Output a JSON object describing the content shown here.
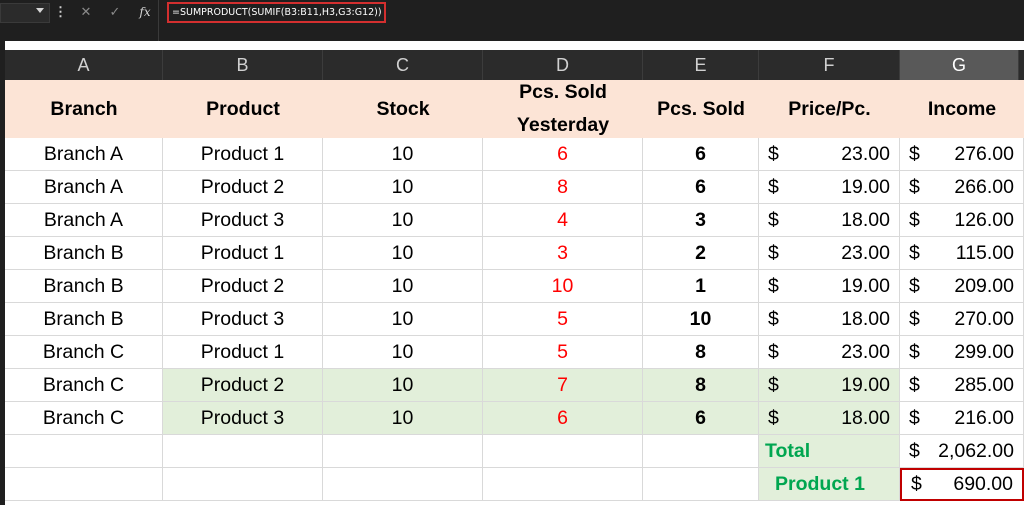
{
  "formula_bar": {
    "name_box": "",
    "cancel_icon": "x-icon",
    "enter_icon": "check-icon",
    "fx_label": "fx",
    "formula": "=SUMPRODUCT(SUMIF(B3:B11,H3,G3:G12))"
  },
  "columns": [
    "A",
    "B",
    "C",
    "D",
    "E",
    "F",
    "G"
  ],
  "selected_column": "G",
  "headers": {
    "branch": "Branch",
    "product": "Product",
    "stock": "Stock",
    "sold_yesterday_1": "Pcs. Sold",
    "sold_yesterday_2": "Yesterday",
    "sold": "Pcs. Sold",
    "price": "Price/Pc.",
    "income": "Income"
  },
  "rows": [
    {
      "branch": "Branch A",
      "product": "Product 1",
      "stock": "10",
      "yesterday": "6",
      "sold": "6",
      "price": "23.00",
      "income": "276.00"
    },
    {
      "branch": "Branch A",
      "product": "Product 2",
      "stock": "10",
      "yesterday": "8",
      "sold": "6",
      "price": "19.00",
      "income": "266.00"
    },
    {
      "branch": "Branch A",
      "product": "Product 3",
      "stock": "10",
      "yesterday": "4",
      "sold": "3",
      "price": "18.00",
      "income": "126.00"
    },
    {
      "branch": "Branch B",
      "product": "Product 1",
      "stock": "10",
      "yesterday": "3",
      "sold": "2",
      "price": "23.00",
      "income": "115.00"
    },
    {
      "branch": "Branch B",
      "product": "Product 2",
      "stock": "10",
      "yesterday": "10",
      "sold": "1",
      "price": "19.00",
      "income": "209.00"
    },
    {
      "branch": "Branch B",
      "product": "Product 3",
      "stock": "10",
      "yesterday": "5",
      "sold": "10",
      "price": "18.00",
      "income": "270.00"
    },
    {
      "branch": "Branch C",
      "product": "Product 1",
      "stock": "10",
      "yesterday": "5",
      "sold": "8",
      "price": "23.00",
      "income": "299.00"
    },
    {
      "branch": "Branch C",
      "product": "Product 2",
      "stock": "10",
      "yesterday": "7",
      "sold": "8",
      "price": "19.00",
      "income": "285.00"
    },
    {
      "branch": "Branch C",
      "product": "Product 3",
      "stock": "10",
      "yesterday": "6",
      "sold": "6",
      "price": "18.00",
      "income": "216.00"
    }
  ],
  "currency_symbol": "$",
  "total": {
    "label": "Total",
    "value": "2,062.00"
  },
  "product_total": {
    "label": "Product 1",
    "value": "690.00"
  }
}
